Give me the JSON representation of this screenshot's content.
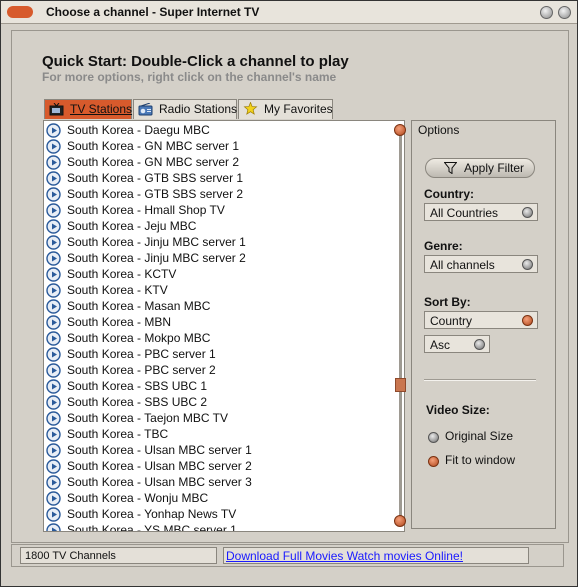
{
  "window": {
    "title": "Choose a channel - Super Internet TV"
  },
  "quickstart": {
    "title": "Quick Start: Double-Click a channel to play",
    "subtitle": "For more options, right click on the channel's name"
  },
  "tabs": [
    {
      "label": "TV Stations",
      "active": true,
      "icon": "tv-icon"
    },
    {
      "label": "Radio Stations",
      "active": false,
      "icon": "radio-icon"
    },
    {
      "label": "My Favorites",
      "active": false,
      "icon": "star-icon"
    }
  ],
  "channels": [
    "South Korea - Daegu MBC",
    "South Korea - GN MBC server 1",
    "South Korea - GN MBC server 2",
    "South Korea - GTB SBS server 1",
    "South Korea - GTB SBS server 2",
    "South Korea - Hmall Shop TV",
    "South Korea - Jeju MBC",
    "South Korea - Jinju MBC server 1",
    "South Korea - Jinju MBC server 2",
    "South Korea - KCTV",
    "South Korea - KTV",
    "South Korea - Masan MBC",
    "South Korea - MBN",
    "South Korea - Mokpo MBC",
    "South Korea - PBC server 1",
    "South Korea - PBC server 2",
    "South Korea - SBS UBC 1",
    "South Korea - SBS UBC 2",
    "South Korea - Taejon MBC TV",
    "South Korea - TBC",
    "South Korea - Ulsan MBC server 1",
    "South Korea - Ulsan MBC server 2",
    "South Korea - Ulsan MBC server 3",
    "South Korea - Wonju MBC",
    "South Korea - Yonhap News TV",
    "South Korea - YS MBC server 1"
  ],
  "options": {
    "title": "Options",
    "apply_filter": "Apply Filter",
    "country_label": "Country:",
    "country_value": "All Countries",
    "genre_label": "Genre:",
    "genre_value": "All channels",
    "sortby_label": "Sort By:",
    "sortby_value": "Country",
    "order_value": "Asc",
    "videosize_label": "Video Size:",
    "videosize_options": [
      "Original Size",
      "Fit to window"
    ],
    "videosize_selected": "Fit to window"
  },
  "status": {
    "count": "1800 TV Channels",
    "link": "Download Full Movies  Watch movies Online!"
  },
  "colors": {
    "accent": "#d75a2c",
    "link": "#1a1aff",
    "background": "#d4d0c8"
  }
}
